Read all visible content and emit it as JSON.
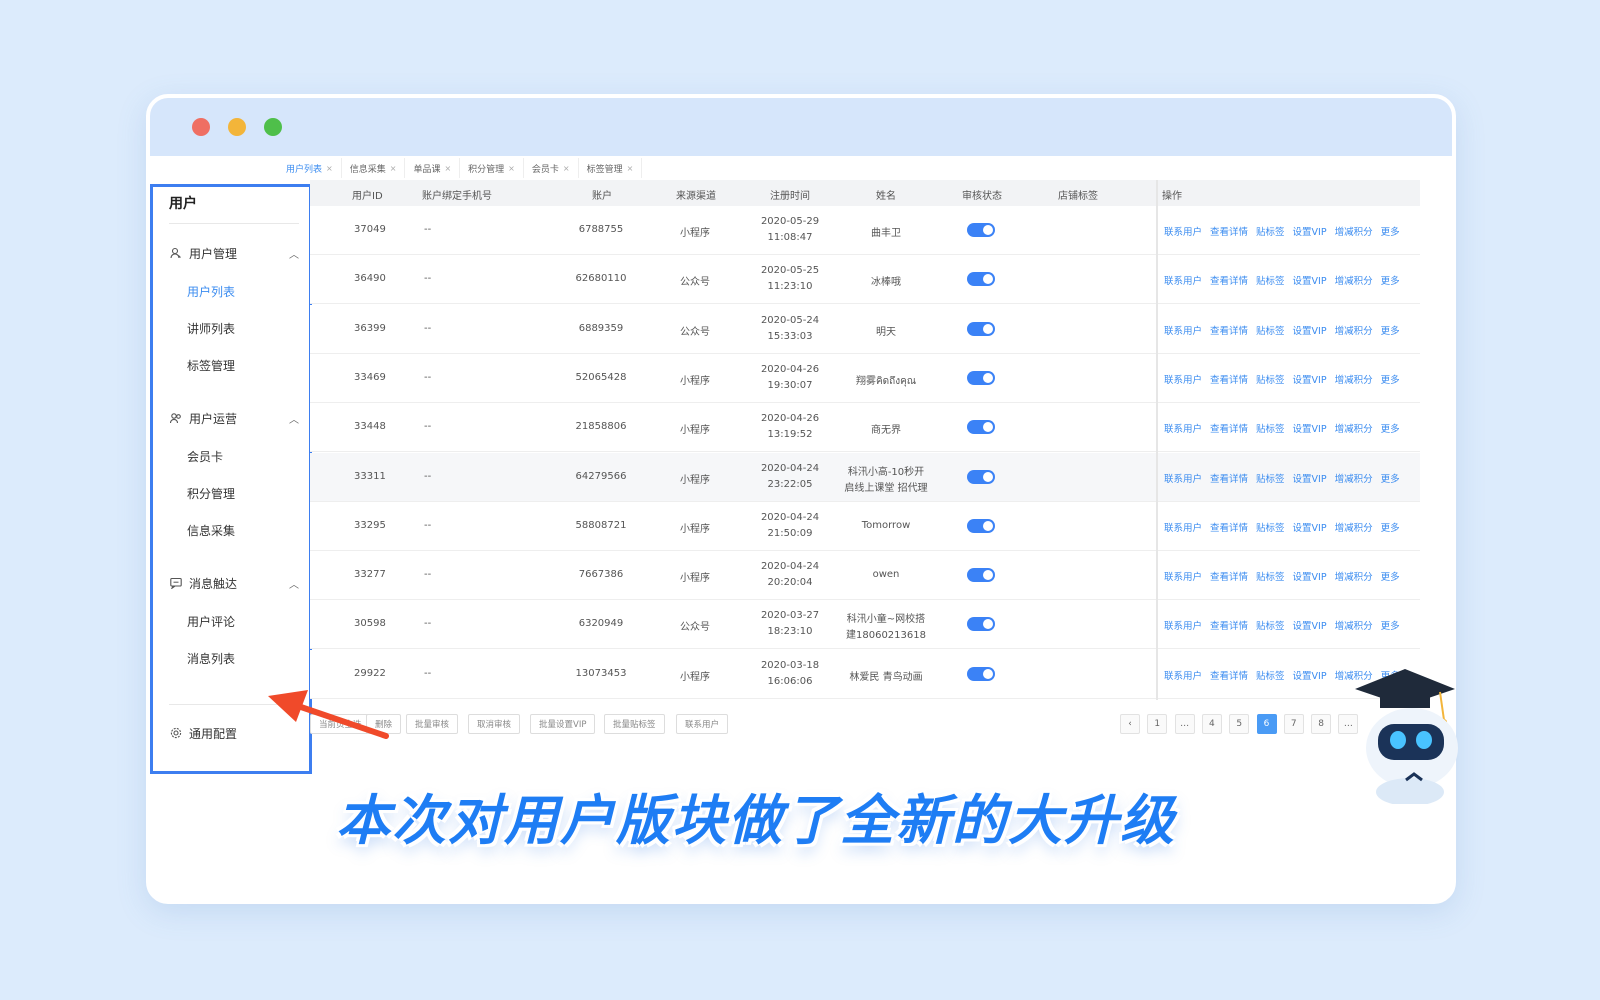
{
  "tabs": [
    {
      "label": "用户列表",
      "active": true
    },
    {
      "label": "信息采集",
      "active": false
    },
    {
      "label": "单品课",
      "active": false
    },
    {
      "label": "积分管理",
      "active": false
    },
    {
      "label": "会员卡",
      "active": false
    },
    {
      "label": "标签管理",
      "active": false
    }
  ],
  "sidebar": {
    "title": "用户",
    "groups": [
      {
        "label": "用户管理",
        "icon": "user-icon",
        "items": [
          "用户列表",
          "讲师列表",
          "标签管理"
        ]
      },
      {
        "label": "用户运营",
        "icon": "users-icon",
        "items": [
          "会员卡",
          "积分管理",
          "信息采集"
        ]
      },
      {
        "label": "消息触达",
        "icon": "message-icon",
        "items": [
          "用户评论",
          "消息列表"
        ]
      }
    ],
    "active_item": "用户列表",
    "settings_label": "通用配置"
  },
  "table": {
    "headers": [
      "用户ID",
      "账户绑定手机号",
      "账户",
      "来源渠道",
      "注册时间",
      "姓名",
      "审核状态",
      "店铺标签",
      "操作"
    ],
    "rows": [
      {
        "id": "37049",
        "phone": "--",
        "account": "6788755",
        "source": "小程序",
        "date": "2020-05-29",
        "time": "11:08:47",
        "name1": "曲丰卫",
        "name2": "",
        "approved": true
      },
      {
        "id": "36490",
        "phone": "--",
        "account": "62680110",
        "source": "公众号",
        "date": "2020-05-25",
        "time": "11:23:10",
        "name1": "冰棒哦",
        "name2": "",
        "approved": true
      },
      {
        "id": "36399",
        "phone": "--",
        "account": "6889359",
        "source": "公众号",
        "date": "2020-05-24",
        "time": "15:33:03",
        "name1": "明天",
        "name2": "",
        "approved": true
      },
      {
        "id": "33469",
        "phone": "--",
        "account": "52065428",
        "source": "小程序",
        "date": "2020-04-26",
        "time": "19:30:07",
        "name1": "翔雾คิดถึงคุณ",
        "name2": "",
        "approved": true
      },
      {
        "id": "33448",
        "phone": "--",
        "account": "21858806",
        "source": "小程序",
        "date": "2020-04-26",
        "time": "13:19:52",
        "name1": "商无界",
        "name2": "",
        "approved": true
      },
      {
        "id": "33311",
        "phone": "--",
        "account": "64279566",
        "source": "小程序",
        "date": "2020-04-24",
        "time": "23:22:05",
        "name1": "科汛小高-10秒开",
        "name2": "启线上课堂 招代理",
        "approved": true
      },
      {
        "id": "33295",
        "phone": "--",
        "account": "58808721",
        "source": "小程序",
        "date": "2020-04-24",
        "time": "21:50:09",
        "name1": "Tomorrow",
        "name2": "",
        "approved": true
      },
      {
        "id": "33277",
        "phone": "--",
        "account": "7667386",
        "source": "小程序",
        "date": "2020-04-24",
        "time": "20:20:04",
        "name1": "owen",
        "name2": "",
        "approved": true
      },
      {
        "id": "30598",
        "phone": "--",
        "account": "6320949",
        "source": "公众号",
        "date": "2020-03-27",
        "time": "18:23:10",
        "name1": "科汛小童~网校搭",
        "name2": "建18060213618",
        "approved": true
      },
      {
        "id": "29922",
        "phone": "--",
        "account": "13073453",
        "source": "小程序",
        "date": "2020-03-18",
        "time": "16:06:06",
        "name1": "林爱民 青鸟动画",
        "name2": "",
        "approved": true
      }
    ],
    "actions": [
      "联系用户",
      "查看详情",
      "贴标签",
      "设置VIP",
      "增减积分",
      "更多"
    ]
  },
  "footer": {
    "buttons": [
      "当前页全选",
      "删除",
      "批量审核",
      "取消审核",
      "批量设置VIP",
      "批量贴标签",
      "联系用户"
    ],
    "pagination": [
      "‹",
      "1",
      "…",
      "4",
      "5",
      "6",
      "7",
      "8",
      "…"
    ],
    "current_page": "6"
  },
  "caption": "本次对用户版块做了全新的大升级",
  "colors": {
    "accent": "#3b8cf0",
    "highlight_border": "#3d7ef0",
    "arrow": "#f04a2a",
    "caption": "#1e7df4"
  }
}
